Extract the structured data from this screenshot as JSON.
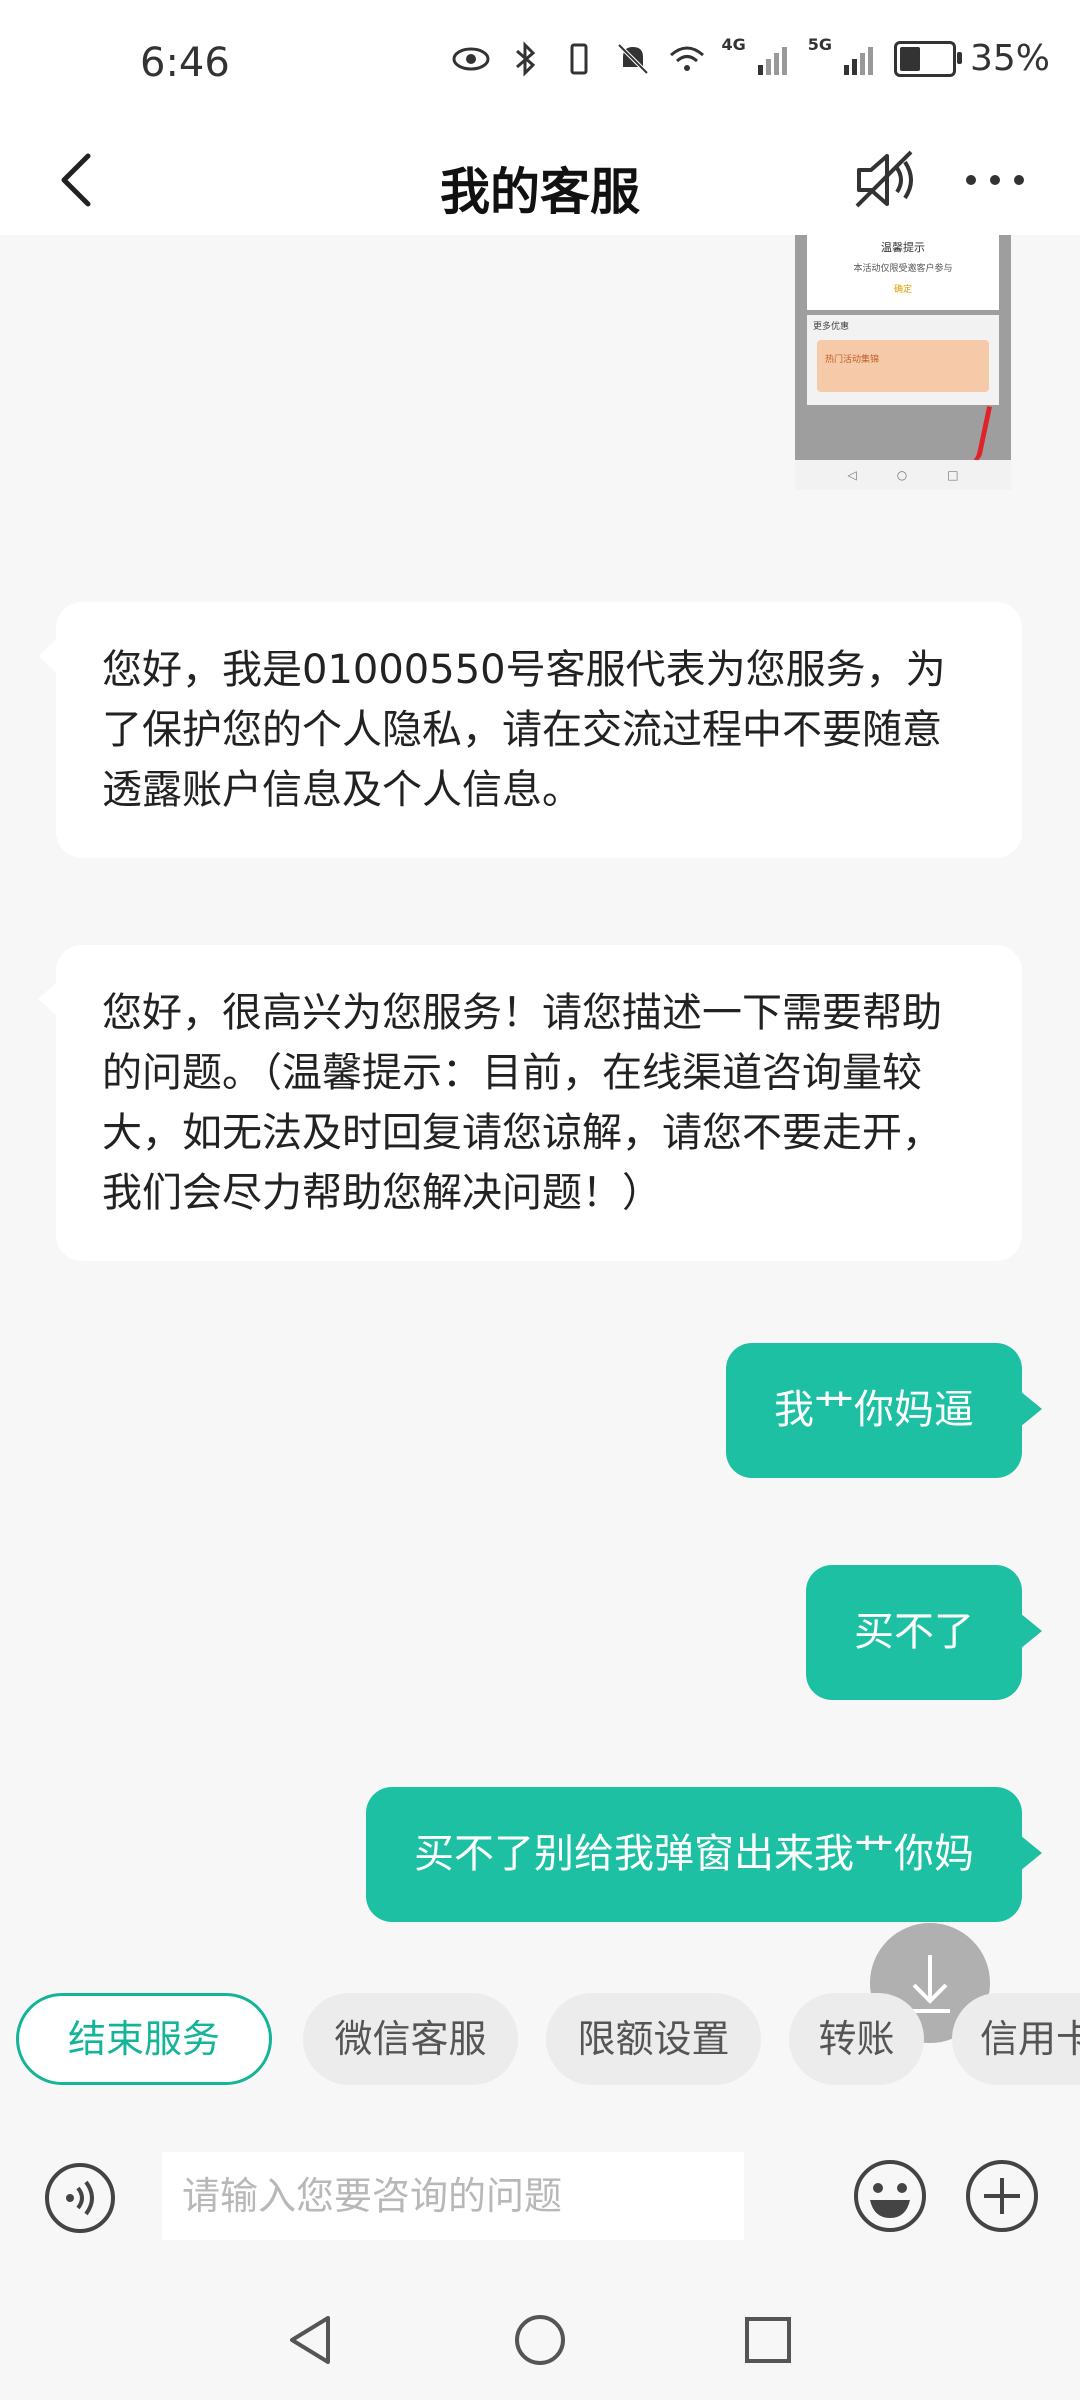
{
  "status_bar": {
    "time": "6:46",
    "network_1": "4G",
    "network_2": "5G",
    "battery": "35%",
    "battery_level": 0.35
  },
  "header": {
    "title": "我的客服"
  },
  "thumbnail": {
    "title": "温馨提示",
    "subtitle": "本活动仅限受邀客户参与",
    "ok_label": "确定",
    "more_label": "更多优惠",
    "banner_label": "热门活动集锦"
  },
  "messages": [
    {
      "from": "agent",
      "text": "您好，我是01000550号客服代表为您服务，为了保护您的个人隐私，请在交流过程中不要随意透露账户信息及个人信息。"
    },
    {
      "from": "agent",
      "text": "您好，很高兴为您服务！请您描述一下需要帮助的问题。（温馨提示：目前，在线渠道咨询量较大，如无法及时回复请您谅解，请您不要走开，我们会尽力帮助您解决问题！）"
    },
    {
      "from": "user",
      "text": "我艹你妈逼"
    },
    {
      "from": "user",
      "text": "买不了"
    },
    {
      "from": "user",
      "text": "买不了别给我弹窗出来我艹你妈"
    }
  ],
  "quick_replies": [
    "结束服务",
    "微信客服",
    "限额设置",
    "转账",
    "信用卡"
  ],
  "input": {
    "placeholder": "请输入您要咨询的问题",
    "value": ""
  },
  "colors": {
    "accent": "#1ec0a3",
    "chip_border": "#13b497",
    "background": "#f7f7f7"
  }
}
